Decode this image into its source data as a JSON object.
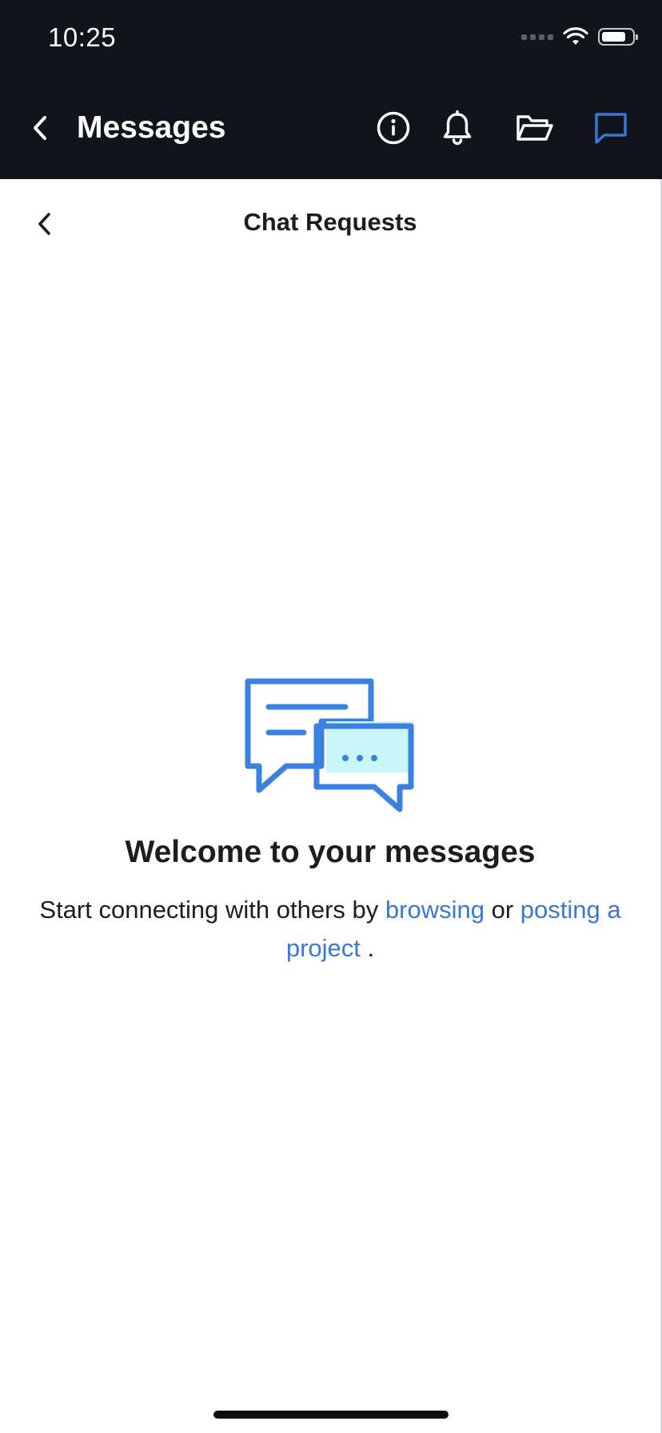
{
  "status_bar": {
    "time": "10:25"
  },
  "nav": {
    "title": "Messages",
    "icons": {
      "back": "chevron-left-icon",
      "info": "info-icon",
      "notifications": "bell-icon",
      "projects": "folder-icon",
      "messages": "chat-bubble-icon"
    },
    "active_color": "#3a78d6"
  },
  "sub_header": {
    "title": "Chat Requests"
  },
  "empty_state": {
    "illustration": "chat-bubbles-illustration",
    "title": "Welcome to your messages",
    "text_before": "Start connecting with others by ",
    "link_browse": "browsing",
    "text_middle": " or ",
    "link_post": "posting a project",
    "text_after": " ."
  },
  "colors": {
    "header_bg": "#12141c",
    "link": "#3a78d6",
    "illustration_blue": "#3b82e0",
    "illustration_fill": "#c9f5fb"
  }
}
